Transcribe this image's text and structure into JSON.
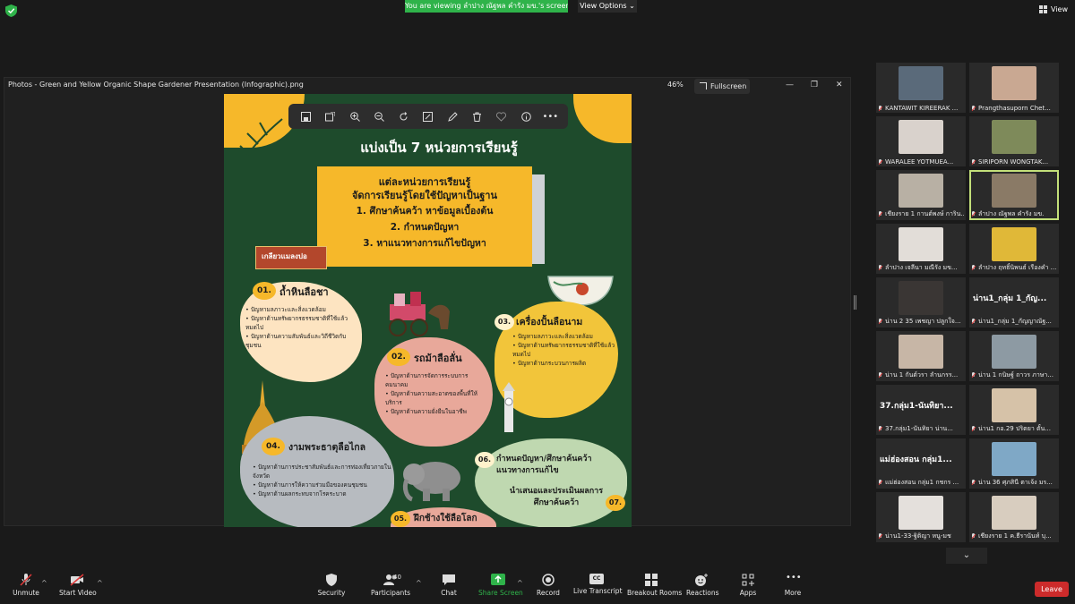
{
  "topbar": {
    "viewing_text": "You are viewing ลำปาง ณัฐพล คำรัง มข.'s screen",
    "view_options": "View Options",
    "view_label": "View"
  },
  "photos": {
    "title": "Photos - Green and Yellow Organic Shape Gardener Presentation (Infographic).png",
    "zoom": "46%",
    "fullscreen": "Fullscreen",
    "minimize": "—",
    "restore": "❐",
    "close": "✕"
  },
  "infographic": {
    "heading": "แบ่งเป็น 7 หน่วยการเรียนรู้",
    "box_lines": [
      "แต่ละหน่วยการเรียนรู้",
      "จัดการเรียนรู้โดยใช้ปัญหาเป็นฐาน",
      "1. ศึกษาค้นคว้า หาข้อมูลเบื้องต้น",
      "2. กำหนดปัญหา",
      "3. หาแนวทางการแก้ไขปัญหา"
    ],
    "banner": "เกลียวแมลงปอ",
    "u01_num": "01.",
    "u01_title": "ถ้ำหินลือชา",
    "u01_items": [
      "ปัญหามลภาวะและสิ่งแวดล้อม",
      "ปัญหาด้านทรัพยากรธรรมชาติที่ใช้แล้วหมดไป",
      "ปัญหาด้านความสัมพันธ์และวิถีชีวิตกับชุมชน"
    ],
    "u02_num": "02.",
    "u02_title": "รถม้าลือลั่น",
    "u02_items": [
      "ปัญหาด้านการจัดการระบบการคมนาคม",
      "ปัญหาด้านความสะอาดของพื้นที่ให้บริการ",
      "ปัญหาด้านความยั่งยืนในอาชีพ"
    ],
    "u03_num": "03.",
    "u03_title": "เครื่องปั้นลือนาม",
    "u03_items": [
      "ปัญหามลภาวะและสิ่งแวดล้อม",
      "ปัญหาด้านทรัพยากรธรรมชาติที่ใช้แล้วหมดไป",
      "ปัญหาด้านกระบวนการผลิต"
    ],
    "u04_num": "04.",
    "u04_title": "งามพระธาตุลือไกล",
    "u04_items": [
      "ปัญหาด้านการประชาสัมพันธ์และการท่องเที่ยวภายในจังหวัด",
      "ปัญหาด้านการให้ความร่วมมือของคนชุมชน",
      "ปัญหาด้านผลกระทบจากโรคระบาด"
    ],
    "u05_num": "05.",
    "u05_title": "ฝึกช้างใช้ลือโลก",
    "u06_num": "06.",
    "u06_title": "กำหนดปัญหา/ศึกษาค้นคว้าแนวทางการแก้ไข",
    "u07_num": "07.",
    "u07_title": "นำเสนอและประเมินผลการศึกษาค้นคว้า"
  },
  "participants": [
    {
      "name": "KANTAWIT KIREERAK ...",
      "big": "",
      "face": "#5a6a7a"
    },
    {
      "name": "Prangthasuporn Chet...",
      "big": "",
      "face": "#c9a892"
    },
    {
      "name": "WARALEE YOTMUEA...",
      "big": "",
      "face": "#d9d2cc"
    },
    {
      "name": "SIRIPORN WONGTAK...",
      "big": "",
      "face": "#7e8a5a"
    },
    {
      "name": "เชียงราย 1 กานต์พงษ์ การิน...",
      "big": "",
      "face": "#b8b0a4"
    },
    {
      "name": "ลำปาง ณัฐพล คำรัง มข.",
      "big": "",
      "face": "#8a7a66"
    },
    {
      "name": "ลำปาง เจลีนา มณีรัง มข...",
      "big": "",
      "face": "#e2ddd8"
    },
    {
      "name": "ลำปาง ฤทธิ์นิพนธ์ เรืองคำ ...",
      "big": "",
      "face": "#e0b838"
    },
    {
      "name": "น่าน 2 35 เพชญา ปลูกใจ...",
      "big": "",
      "face": "#3a3634"
    },
    {
      "name": "น่าน1_กลุ่ม 1_กัญญาณัฐ...",
      "big": "น่าน1_กลุ่ม 1_กัญ...",
      "face": ""
    },
    {
      "name": "น่าน 1 กันต์วรา ลำนกรร...",
      "big": "",
      "face": "#c7b6a6"
    },
    {
      "name": "น่าน 1 กนิษฐ์ ถาวร ภาษา...",
      "big": "",
      "face": "#8d9aa3"
    },
    {
      "name": "37.กลุ่ม1-นันทิยา น่าน...",
      "big": "37.กลุ่ม1-นันทิยา...",
      "face": ""
    },
    {
      "name": "น่าน1 กอ.29 ปริตยา ตั้น...",
      "big": "",
      "face": "#d6c2a8"
    },
    {
      "name": "แม่ฮ่องสอน กลุ่ม1 กชกร ...",
      "big": "แม่ฮ่องสอน กลุ่ม1...",
      "face": ""
    },
    {
      "name": "น่าน 36 ศุภสินี ตาเจ้ง มร...",
      "big": "",
      "face": "#7fa8c6"
    },
    {
      "name": "น่าน1-33-ฐิติญา หนู-มช",
      "big": "",
      "face": "#e4e0dc"
    },
    {
      "name": "เชียงราย 1 ค.ธีรานันท์ บุ...",
      "big": "",
      "face": "#d8cdbf"
    }
  ],
  "bottombar": {
    "unmute": "Unmute",
    "start_video": "Start Video",
    "security": "Security",
    "participants": "Participants",
    "participants_count": "40",
    "chat": "Chat",
    "share_screen": "Share Screen",
    "record": "Record",
    "live_transcript": "Live Transcript",
    "cc": "CC",
    "breakout_rooms": "Breakout Rooms",
    "reactions": "Reactions",
    "apps": "Apps",
    "more": "More",
    "leave": "Leave"
  },
  "colors": {
    "green": "#1e4b2c",
    "yellow": "#f6b82a",
    "share_green": "#2fb34a",
    "leave_red": "#cc2b2b"
  }
}
